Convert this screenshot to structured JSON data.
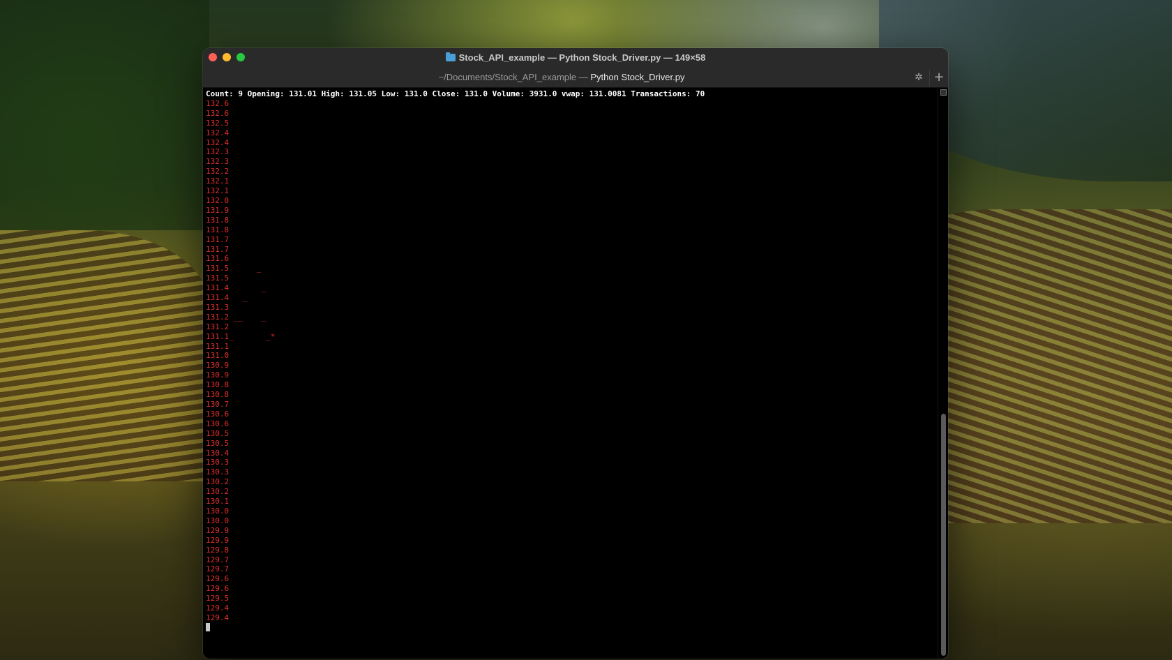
{
  "window": {
    "title": "Stock_API_example — Python Stock_Driver.py — 149×58",
    "tab_path": "~/Documents/Stock_API_example — ",
    "tab_name": "Python Stock_Driver.py"
  },
  "terminal": {
    "summary": "Count: 9 Opening: 131.01 High: 131.05 Low: 131.0 Close: 131.0 Volume: 3931.0 vwap: 131.0081 Transactions: 70",
    "lines": [
      "132.6",
      "132.6",
      "132.5",
      "132.4",
      "132.4",
      "132.3",
      "132.3",
      "132.2",
      "132.1",
      "132.1",
      "132.0",
      "131.9",
      "131.8",
      "131.8",
      "131.7",
      "131.7",
      "131.6",
      "131.5      _",
      "131.5",
      "131.4       _",
      "131.4   _",
      "131.3",
      "131.2 __    _",
      "131.2",
      "131.1_       _*",
      "131.1",
      "131.0",
      "130.9",
      "130.9",
      "130.8",
      "130.8",
      "130.7",
      "130.6",
      "130.6",
      "130.5",
      "130.5",
      "130.4",
      "130.3",
      "130.3",
      "130.2",
      "130.2",
      "130.1",
      "130.0",
      "130.0",
      "129.9",
      "129.9",
      "129.8",
      "129.7",
      "129.7",
      "129.6",
      "129.6",
      "129.5",
      "129.4",
      "129.4"
    ]
  },
  "colors": {
    "terminal_bg": "#000000",
    "price_text": "#e0302c",
    "summary_text": "#ffffff",
    "titlebar": "#2a2a2a"
  }
}
